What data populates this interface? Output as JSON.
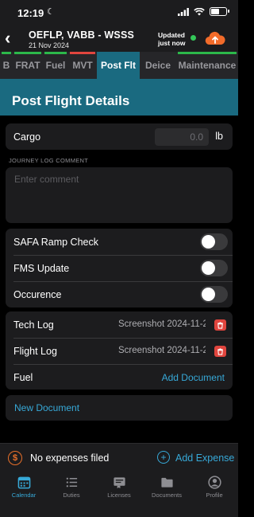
{
  "status_bar": {
    "time": "12:19"
  },
  "header": {
    "route": "OEFLP, VABB - WSSS",
    "date": "21 Nov 2024",
    "updated_line1": "Updated",
    "updated_line2": "just now"
  },
  "tabs": [
    {
      "label": "B",
      "bar_color": "#2cb84a"
    },
    {
      "label": "FRAT",
      "bar_color": "#2cb84a"
    },
    {
      "label": "Fuel",
      "bar_color": "#2cb84a"
    },
    {
      "label": "MVT",
      "bar_color": "#e0453e"
    },
    {
      "label": "Post Flt",
      "bar_color": "",
      "active": true
    },
    {
      "label": "Deice",
      "bar_color": ""
    },
    {
      "label": "Maintenance",
      "bar_color": "#2cb84a"
    }
  ],
  "section_title": "Post Flight Details",
  "cargo": {
    "label": "Cargo",
    "placeholder": "0.0",
    "unit": "lb"
  },
  "journey_log": {
    "caption": "JOURNEY LOG COMMENT",
    "placeholder": "Enter comment"
  },
  "toggles": [
    {
      "label": "SAFA Ramp Check",
      "on": false
    },
    {
      "label": "FMS Update",
      "on": false
    },
    {
      "label": "Occurence",
      "on": false
    }
  ],
  "documents": [
    {
      "label": "Tech Log",
      "file": "Screenshot 2024-11-22..."
    },
    {
      "label": "Flight Log",
      "file": "Screenshot 2024-11-22..."
    },
    {
      "label": "Fuel",
      "action": "Add Document"
    }
  ],
  "new_document": "New Document",
  "expenses": {
    "text": "No expenses filed",
    "action": "Add Expense"
  },
  "nav": [
    {
      "label": "Calendar",
      "icon": "calendar-icon",
      "active": true
    },
    {
      "label": "Duties",
      "icon": "list-icon"
    },
    {
      "label": "Licenses",
      "icon": "license-icon"
    },
    {
      "label": "Documents",
      "icon": "folder-icon"
    },
    {
      "label": "Profile",
      "icon": "profile-icon"
    }
  ],
  "colors": {
    "accent": "#1a6a80",
    "link": "#37a9d8",
    "upload": "#f26b2a",
    "online": "#34c759",
    "delete": "#e0453e"
  }
}
